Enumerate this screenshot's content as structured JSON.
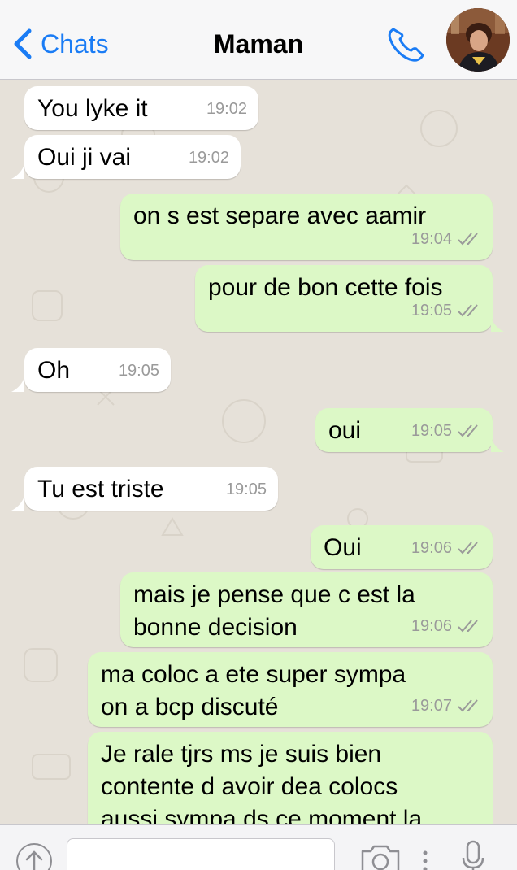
{
  "header": {
    "back_label": "Chats",
    "title": "Maman"
  },
  "colors": {
    "accent": "#1a7cf5",
    "incoming_bubble": "#ffffff",
    "outgoing_bubble": "#dcf8c6",
    "chat_background": "#e6e1d9"
  },
  "messages": [
    {
      "direction": "in",
      "text": "You lyke it",
      "time": "19:02"
    },
    {
      "direction": "in",
      "text": "Oui ji vai",
      "time": "19:02"
    },
    {
      "direction": "out",
      "text": "on s est separe avec aamir",
      "time": "19:04",
      "status": "read"
    },
    {
      "direction": "out",
      "text": "pour de bon cette fois",
      "time": "19:05",
      "status": "read"
    },
    {
      "direction": "in",
      "text": "Oh",
      "time": "19:05"
    },
    {
      "direction": "out",
      "text": "oui",
      "time": "19:05",
      "status": "read"
    },
    {
      "direction": "in",
      "text": "Tu est triste",
      "time": "19:05"
    },
    {
      "direction": "out",
      "text": "Oui",
      "time": "19:06",
      "status": "read"
    },
    {
      "direction": "out",
      "line1": "mais je pense que c est la",
      "line2": "bonne decision",
      "time": "19:06",
      "status": "read"
    },
    {
      "direction": "out",
      "line1": "ma coloc a ete super sympa",
      "line2": "on a bcp discuté",
      "time": "19:07",
      "status": "read"
    },
    {
      "direction": "out",
      "line1": "Je rale tjrs ms je suis bien",
      "line2": "contente d avoir dea colocs",
      "line3": "aussi sympa ds ce moment la"
    }
  ],
  "icons": {
    "back": "chevron-left-icon",
    "call": "phone-icon",
    "attach": "arrow-up-circle-icon",
    "camera": "camera-icon",
    "more": "vertical-dots-icon",
    "mic": "microphone-icon"
  },
  "input": {
    "value": "",
    "placeholder": ""
  }
}
